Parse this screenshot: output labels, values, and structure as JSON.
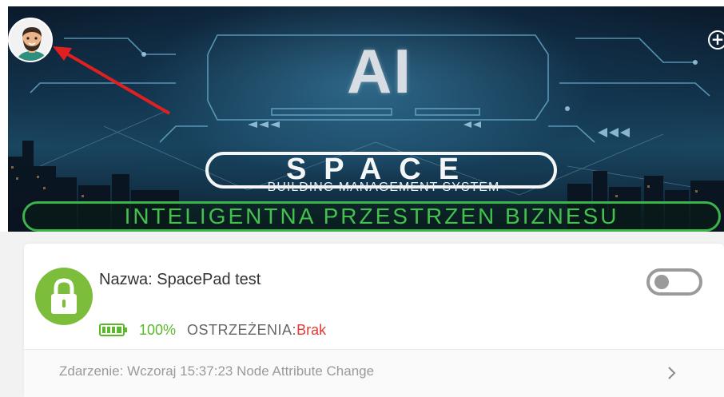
{
  "banner": {
    "ai_title": "AI",
    "logo_word": "SPACE",
    "logo_subtitle": "BUILDING MANAGEMENT SYSTEM",
    "slogan": "INTELIGENTNA PRZESTRZEN BIZNESU",
    "add_icon": "plus-circle-icon",
    "colors": {
      "slogan_green": "#42c24d",
      "sky": "#12324a"
    }
  },
  "header": {
    "avatar_icon": "user-avatar-icon",
    "annotation": "red-arrow"
  },
  "device": {
    "name_label": "Nazwa:",
    "name_value": "SpacePad test",
    "icon": "lock-icon",
    "icon_color": "#7cbd3b",
    "toggle_state": "off",
    "battery_icon": "battery-full-icon",
    "battery_value": "100%",
    "warnings_label": "OSTRZEŻENIA:",
    "warnings_value": "Brak",
    "event_label": "Zdarzenie:",
    "event_value": "Wczoraj 15:37:23 Node Attribute Change",
    "chevron_icon": "chevron-right-icon"
  }
}
